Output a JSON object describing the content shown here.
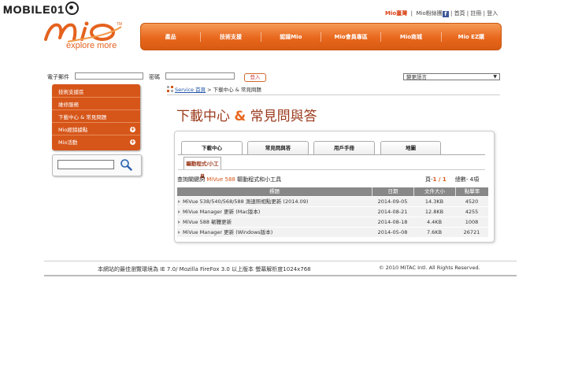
{
  "watermark": "MOBILE01",
  "logo": {
    "tagline": "explore more",
    "tm": "TM"
  },
  "toplinks": {
    "mio_taiwan": "Mio臺灣",
    "fans": "Mio粉絲團",
    "home": "首頁",
    "register": "註冊",
    "login": "登入",
    "sep": "|",
    "fb_glyph": "f"
  },
  "nav": [
    "產品",
    "技術支援",
    "認識Mio",
    "Mio會員專區",
    "Mio商城",
    "Mio EZ購"
  ],
  "login": {
    "email_label": "電子郵件",
    "password_label": "密碼",
    "button": "登入"
  },
  "language_select": "變更語言",
  "sidebar": [
    {
      "label": "技術支援區"
    },
    {
      "label": "維修服務"
    },
    {
      "label": "下載中心 & 常見問題"
    },
    {
      "label": "Mio經銷據點",
      "plus": "+"
    },
    {
      "label": "Mio活動",
      "plus": "+"
    }
  ],
  "breadcrumb": {
    "link": "Service 首頁",
    "rest": " > 下載中心 & 常見問題"
  },
  "page_title": {
    "part1": "下載中心",
    "amp": "&",
    "part2": "常見問與答"
  },
  "tabs": [
    "下載中心",
    "常見問與答",
    "用戶手冊",
    "地圖"
  ],
  "subtab": "驅動程式/小工具",
  "query": {
    "prefix": "查詢關鍵詞 ",
    "model": "MiVue 588",
    "suffix": " 驅動程式和小工具"
  },
  "pageinfo": {
    "page_label": "頁-",
    "page": "1 / 1",
    "total_label": "總數- ",
    "total": "4項"
  },
  "table": {
    "headers": [
      "標題",
      "日期",
      "文件大小",
      "點擊率"
    ],
    "rows": [
      {
        "title": "MiVue 538/540/568/588 測速照相點更新 (2014.09)",
        "date": "2014-09-05",
        "size": "14.3KB",
        "hits": "4520"
      },
      {
        "title": "MiVue Manager 更新 (Mac版本)",
        "date": "2014-08-21",
        "size": "12.8KB",
        "hits": "4255"
      },
      {
        "title": "MiVue 588 韌體更新",
        "date": "2014-08-18",
        "size": "4.4KB",
        "hits": "1008"
      },
      {
        "title": "MiVue Manager 更新 (Windows版本)",
        "date": "2014-05-08",
        "size": "7.6KB",
        "hits": "26721"
      }
    ]
  },
  "footer": {
    "browser_note": "本網站的最佳瀏覽環境為 IE 7.0/ Mozilla FireFox 3.0 以上版本 螢幕解析度1024x768",
    "copyright": "© 2010 MITAC Intl. All Rights Reserved."
  },
  "colors": {
    "brand_orange": "#e8671d",
    "title_brown": "#9b3a1c",
    "sidebar": "#d6561a"
  }
}
